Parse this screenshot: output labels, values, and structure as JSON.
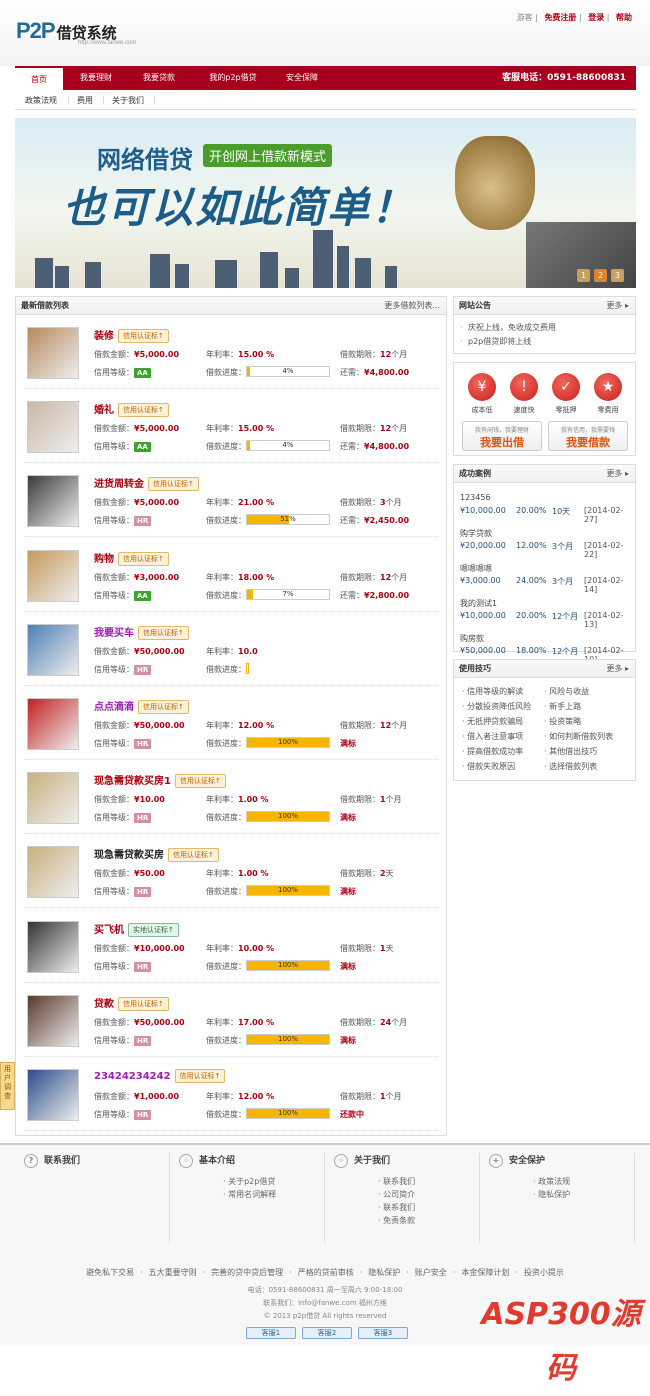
{
  "header": {
    "logo_text": "P2P",
    "logo_cn": "借贷系统",
    "logo_sub": "http://www.fanwe.com",
    "top_links": [
      "游客",
      "免费注册",
      "登录",
      "帮助"
    ],
    "hotline": "客服电话：0591-88600831"
  },
  "nav": {
    "items": [
      "首页",
      "我要理财",
      "我要贷款",
      "我的p2p借贷",
      "安全保障"
    ],
    "sub_items": [
      "政策法规",
      "费用",
      "关于我们"
    ]
  },
  "banner": {
    "line1": "网络借贷",
    "tag": "开创网上借款新模式",
    "line2": "也可以如此简单！",
    "pages": [
      "1",
      "2",
      "3"
    ]
  },
  "list": {
    "title": "最新借款列表",
    "more": "更多借款列表...",
    "labels": {
      "amount": "借款金额：",
      "rate": "年利率：",
      "term": "借款期限：",
      "level": "信用等级：",
      "progress": "借款进度：",
      "remain": "还需："
    },
    "loans": [
      {
        "title": "装修",
        "badge": "信用认证标",
        "amount": "¥5,000.00",
        "rate": "15.00 %",
        "term": "12",
        "unit": "个月",
        "level": "AA",
        "progress": 0.04,
        "progress_label": "4%",
        "remain": "¥4,800.00",
        "status": ""
      },
      {
        "title": "婚礼",
        "badge": "信用认证标",
        "amount": "¥5,000.00",
        "rate": "15.00 %",
        "term": "12",
        "unit": "个月",
        "level": "AA",
        "progress": 0.04,
        "progress_label": "4%",
        "remain": "¥4,800.00",
        "status": ""
      },
      {
        "title": "进货周转金",
        "badge": "信用认证标",
        "amount": "¥5,000.00",
        "rate": "21.00 %",
        "term": "3",
        "unit": "个月",
        "level": "HR",
        "progress": 0.51,
        "progress_label": "51%",
        "remain": "¥2,450.00",
        "status": ""
      },
      {
        "title": "购物",
        "badge": "信用认证标",
        "amount": "¥3,000.00",
        "rate": "18.00 %",
        "term": "12",
        "unit": "个月",
        "level": "AA",
        "progress": 0.07,
        "progress_label": "7%",
        "remain": "¥2,800.00",
        "status": ""
      },
      {
        "title": "我要买车",
        "badge": "信用认证标",
        "amount": "¥50,000.00",
        "rate": "10.0",
        "term": "",
        "unit": "",
        "level": "HR",
        "progress": 0.0,
        "progress_label": "",
        "remain": "",
        "status": ""
      },
      {
        "title": "点点滴滴",
        "badge": "信用认证标",
        "amount": "¥50,000.00",
        "rate": "12.00 %",
        "term": "12",
        "unit": "个月",
        "level": "HR",
        "progress": 1.0,
        "progress_label": "100%",
        "remain": "",
        "status": "满标"
      },
      {
        "title": "现急需贷款买房1",
        "badge": "信用认证标",
        "amount": "¥10.00",
        "rate": "1.00 %",
        "term": "1",
        "unit": "个月",
        "level": "HR",
        "progress": 1.0,
        "progress_label": "100%",
        "remain": "",
        "status": "满标"
      },
      {
        "title": "现急需贷款买房",
        "badge": "信用认证标",
        "amount": "¥50.00",
        "rate": "1.00 %",
        "term": "2",
        "unit": "天",
        "level": "HR",
        "progress": 1.0,
        "progress_label": "100%",
        "remain": "",
        "status": "满标"
      },
      {
        "title": "买飞机",
        "badge": "实地认证标",
        "amount": "¥10,000.00",
        "rate": "10.00 %",
        "term": "1",
        "unit": "天",
        "level": "HR",
        "progress": 1.0,
        "progress_label": "100%",
        "remain": "",
        "status": "满标"
      },
      {
        "title": "贷款",
        "badge": "信用认证标",
        "amount": "¥50,000.00",
        "rate": "17.00 %",
        "term": "24",
        "unit": "个月",
        "level": "HR",
        "progress": 1.0,
        "progress_label": "100%",
        "remain": "",
        "status": "满标"
      },
      {
        "title": "23424234242",
        "badge": "信用认证标",
        "amount": "¥1,000.00",
        "rate": "12.00 %",
        "term": "1",
        "unit": "个月",
        "level": "HR",
        "progress": 1.0,
        "progress_label": "100%",
        "remain": "",
        "status": "还款中"
      }
    ]
  },
  "notice": {
    "title": "网站公告",
    "more": "更多",
    "items": [
      "庆祝上线，免收成交费用",
      "p2p借贷即将上线"
    ]
  },
  "features": {
    "items": [
      "成本低",
      "速度快",
      "零抵押",
      "零费用"
    ],
    "cta_invest_small": "我有闲钱，我要理财",
    "cta_invest": "我要出借",
    "cta_borrow_small": "我有信用，我需要钱",
    "cta_borrow": "我要借款"
  },
  "cases": {
    "title": "成功案例",
    "more": "更多",
    "rows": [
      {
        "name": "123456",
        "amount": "¥10,000.00",
        "rate": "20.00%",
        "term": "10天",
        "date": "[2014-02-27]"
      },
      {
        "name": "购学贷款",
        "amount": "¥20,000.00",
        "rate": "12.00%",
        "term": "3个月",
        "date": "[2014-02-22]"
      },
      {
        "name": "嗯嗯嗯嗯",
        "amount": "¥3,000.00",
        "rate": "24.00%",
        "term": "3个月",
        "date": "[2014-02-14]"
      },
      {
        "name": "我的测试1",
        "amount": "¥10,000.00",
        "rate": "20.00%",
        "term": "12个月",
        "date": "[2014-02-13]"
      },
      {
        "name": "购房款",
        "amount": "¥50,000.00",
        "rate": "18.00%",
        "term": "12个月",
        "date": "[2014-02-10]"
      }
    ]
  },
  "tips": {
    "title": "使用技巧",
    "more": "更多",
    "left": [
      "信用等级的解读",
      "分散投资降低风险",
      "无抵押贷款骗局",
      "借入者注意事项",
      "提高借款成功率",
      "借款失败原因"
    ],
    "right": [
      "风险与收益",
      "新手上路",
      "投资策略",
      "如何判断借款列表",
      "其他借出技巧",
      "选择借款列表"
    ]
  },
  "footer": {
    "cols": [
      {
        "title": "联系我们",
        "items": []
      },
      {
        "title": "基本介绍",
        "items": [
          "关于p2p借贷",
          "常用名词解释"
        ]
      },
      {
        "title": "关于我们",
        "items": [
          "联系我们",
          "公司简介",
          "联系我们",
          "免责条款"
        ]
      },
      {
        "title": "安全保护",
        "items": [
          "政策法规",
          "隐私保护"
        ]
      }
    ],
    "links": [
      "避免私下交易",
      "五大重要守则",
      "完善的贷中贷后管理",
      "严格的贷前审核",
      "隐私保护",
      "账户安全",
      "本金保障计划",
      "投资小提示"
    ],
    "tel": "电话：0591-88600831 周一至周六 9:00-18:00",
    "contact": "联系我们：info@fanwe.com   福州方维",
    "copyright": "© 2013 p2p借贷 All rights reserved",
    "qq": [
      "客服1",
      "客服2",
      "客服3"
    ],
    "watermark": "ASP300源码",
    "help_tab": "用户调查"
  }
}
